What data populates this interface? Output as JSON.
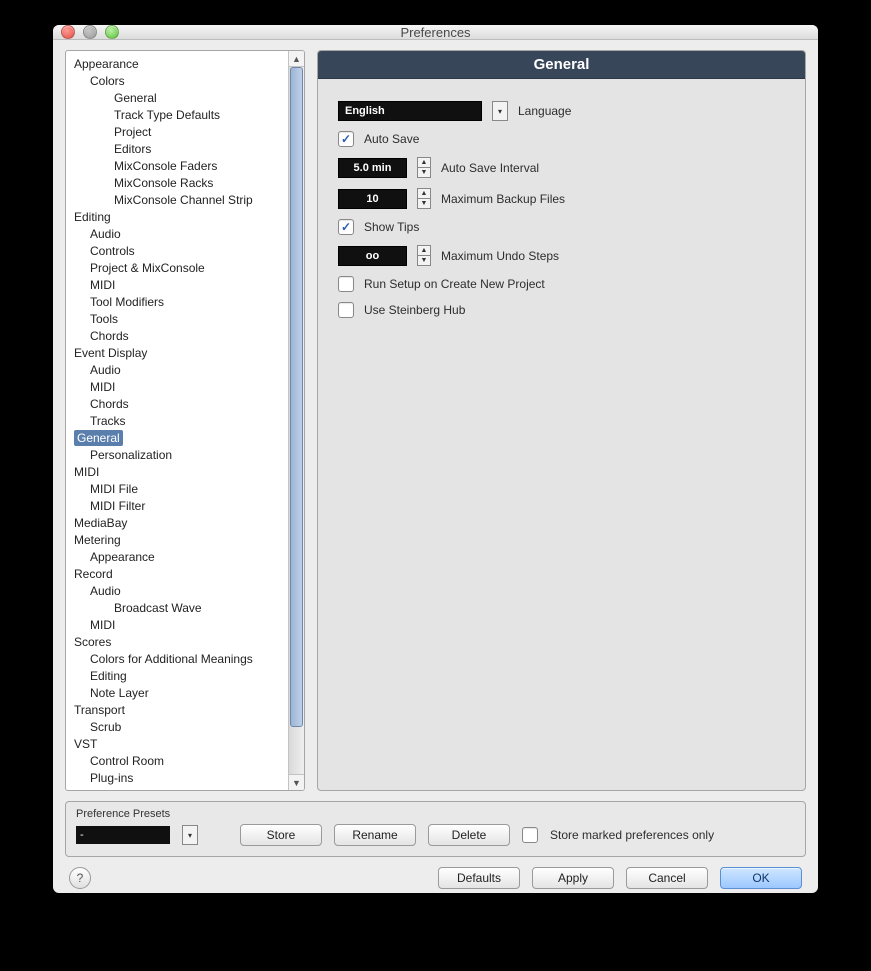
{
  "window": {
    "title": "Preferences"
  },
  "sidebar": {
    "items": [
      {
        "label": "Appearance",
        "depth": 0
      },
      {
        "label": "Colors",
        "depth": 1
      },
      {
        "label": "General",
        "depth": 2
      },
      {
        "label": "Track Type Defaults",
        "depth": 2
      },
      {
        "label": "Project",
        "depth": 2
      },
      {
        "label": "Editors",
        "depth": 2
      },
      {
        "label": "MixConsole Faders",
        "depth": 2
      },
      {
        "label": "MixConsole Racks",
        "depth": 2
      },
      {
        "label": "MixConsole Channel Strip",
        "depth": 2
      },
      {
        "label": "Editing",
        "depth": 0
      },
      {
        "label": "Audio",
        "depth": 1
      },
      {
        "label": "Controls",
        "depth": 1
      },
      {
        "label": "Project & MixConsole",
        "depth": 1
      },
      {
        "label": "MIDI",
        "depth": 1
      },
      {
        "label": "Tool Modifiers",
        "depth": 1
      },
      {
        "label": "Tools",
        "depth": 1
      },
      {
        "label": "Chords",
        "depth": 1
      },
      {
        "label": "Event Display",
        "depth": 0
      },
      {
        "label": "Audio",
        "depth": 1
      },
      {
        "label": "MIDI",
        "depth": 1
      },
      {
        "label": "Chords",
        "depth": 1
      },
      {
        "label": "Tracks",
        "depth": 1
      },
      {
        "label": "General",
        "depth": 0,
        "selected": true
      },
      {
        "label": "Personalization",
        "depth": 1
      },
      {
        "label": "MIDI",
        "depth": 0
      },
      {
        "label": "MIDI File",
        "depth": 1
      },
      {
        "label": "MIDI Filter",
        "depth": 1
      },
      {
        "label": "MediaBay",
        "depth": 0
      },
      {
        "label": "Metering",
        "depth": 0
      },
      {
        "label": "Appearance",
        "depth": 1
      },
      {
        "label": "Record",
        "depth": 0
      },
      {
        "label": "Audio",
        "depth": 1
      },
      {
        "label": "Broadcast Wave",
        "depth": 2
      },
      {
        "label": "MIDI",
        "depth": 1
      },
      {
        "label": "Scores",
        "depth": 0
      },
      {
        "label": "Colors for Additional Meanings",
        "depth": 1
      },
      {
        "label": "Editing",
        "depth": 1
      },
      {
        "label": "Note Layer",
        "depth": 1
      },
      {
        "label": "Transport",
        "depth": 0
      },
      {
        "label": "Scrub",
        "depth": 1
      },
      {
        "label": "VST",
        "depth": 0
      },
      {
        "label": "Control Room",
        "depth": 1
      },
      {
        "label": "Plug-ins",
        "depth": 1
      }
    ]
  },
  "panel": {
    "title": "General",
    "language_value": "English",
    "language_label": "Language",
    "autosave_label": "Auto Save",
    "autosave_checked": true,
    "interval_value": "5.0 min",
    "interval_label": "Auto Save Interval",
    "backup_value": "10",
    "backup_label": "Maximum Backup Files",
    "showtips_label": "Show Tips",
    "showtips_checked": true,
    "undo_value": "oo",
    "undo_label": "Maximum Undo Steps",
    "runsetup_label": "Run Setup on Create New Project",
    "runsetup_checked": false,
    "hub_label": "Use Steinberg Hub",
    "hub_checked": false
  },
  "presets": {
    "title": "Preference Presets",
    "value": "-",
    "store": "Store",
    "rename": "Rename",
    "delete": "Delete",
    "marked_label": "Store marked preferences only",
    "marked_checked": false
  },
  "buttons": {
    "help": "?",
    "defaults": "Defaults",
    "apply": "Apply",
    "cancel": "Cancel",
    "ok": "OK"
  }
}
